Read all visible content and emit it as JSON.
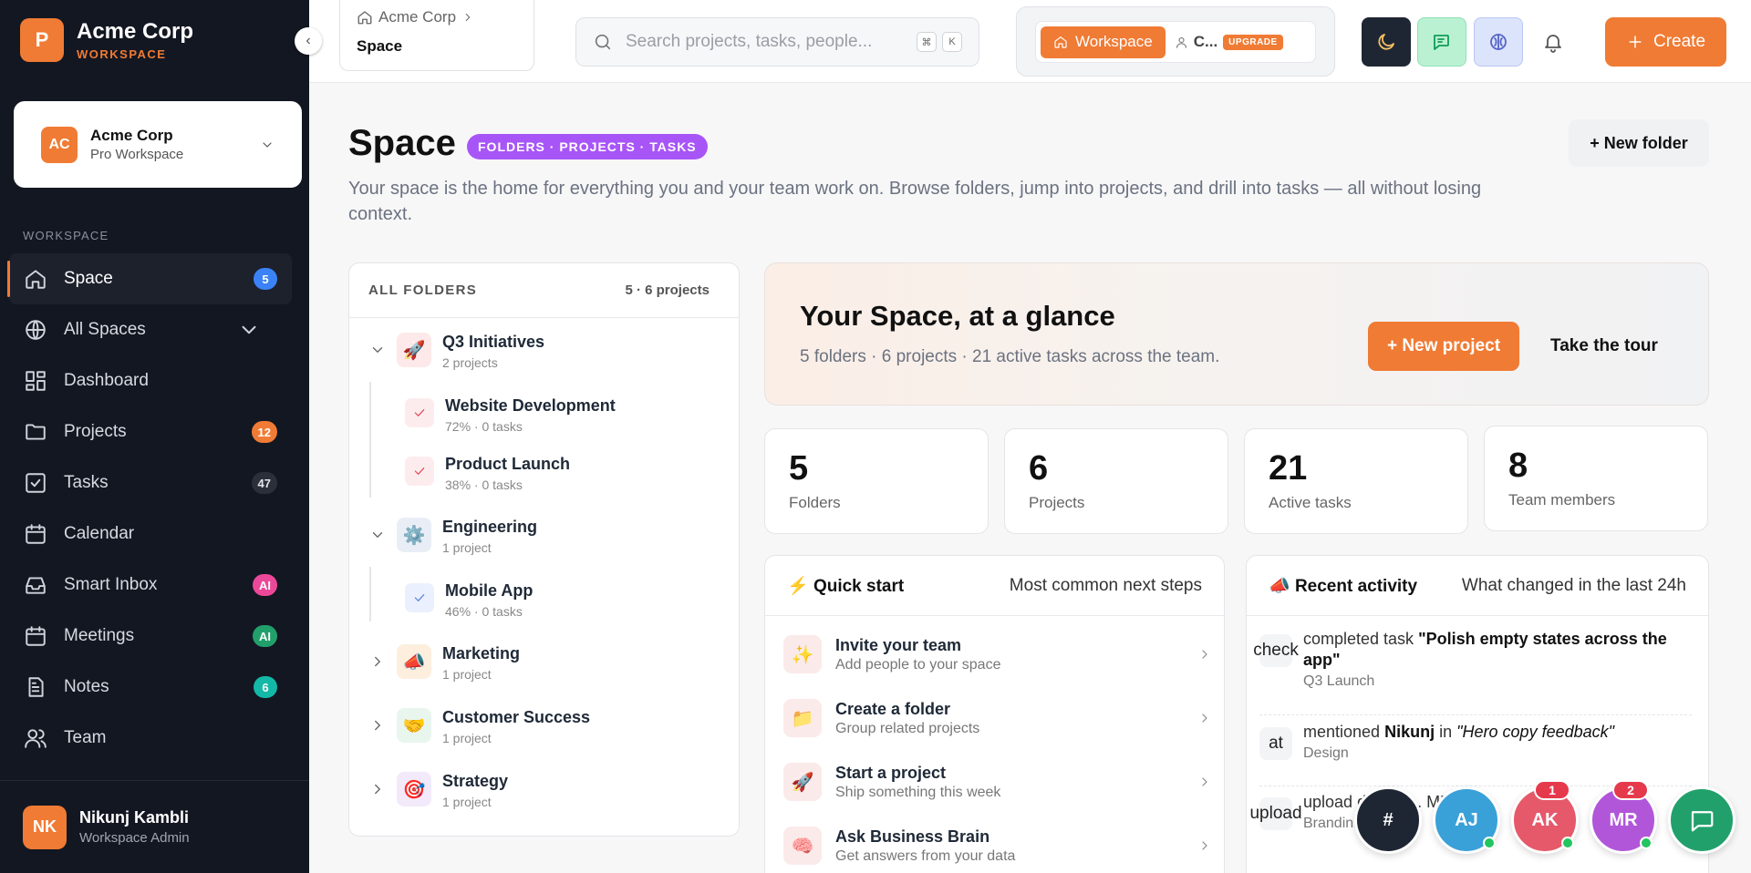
{
  "brand": {
    "logo_letter": "P",
    "name": "Acme Corp",
    "subtitle": "WORKSPACE",
    "accent": "#f07b34"
  },
  "workspace_card": {
    "initials": "AC",
    "name": "Acme Corp",
    "plan": "Pro Workspace"
  },
  "sidebar": {
    "section_label": "WORKSPACE",
    "items": [
      {
        "label": "Space",
        "icon": "home-icon",
        "badge": "5",
        "active": true
      },
      {
        "label": "All Spaces",
        "icon": "globe-icon",
        "chevron": true
      },
      {
        "label": "Dashboard",
        "icon": "dashboard-icon"
      },
      {
        "label": "Projects",
        "icon": "folder-icon",
        "badge": "12"
      },
      {
        "label": "Tasks",
        "icon": "checkbox-icon",
        "badge": "47"
      },
      {
        "label": "Calendar",
        "icon": "calendar-icon"
      },
      {
        "label": "Smart Inbox",
        "icon": "inbox-icon",
        "badge": "AI"
      },
      {
        "label": "Meetings",
        "icon": "calendar-icon",
        "badge": "AI"
      },
      {
        "label": "Notes",
        "icon": "note-icon",
        "badge": "6"
      },
      {
        "label": "Team",
        "icon": "users-icon"
      }
    ],
    "user": {
      "initials": "NK",
      "name": "Nikunj Kambli",
      "role": "Workspace Admin"
    }
  },
  "topbar": {
    "breadcrumb": {
      "parent": "Acme Corp",
      "current": "Space"
    },
    "search": {
      "placeholder": "Search projects, tasks, people...",
      "kbd1": "⌘",
      "kbd2": "K"
    },
    "mode": {
      "workspace_label": "Workspace",
      "other_label": "C...",
      "upgrade_label": "UPGRADE"
    },
    "create_label": "Create"
  },
  "page": {
    "title": "Space",
    "pill": "FOLDERS · PROJECTS · TASKS",
    "new_folder_label": "+ New folder",
    "description": "Your space is the home for everything you and your team work on. Browse folders, jump into projects, and drill into tasks — all without losing context."
  },
  "folders": {
    "header": "ALL FOLDERS",
    "count": "5 · 6 projects",
    "list": [
      {
        "name": "Q3 Initiatives",
        "sub": "2 projects",
        "emoji": "🚀",
        "expanded": true,
        "projects": [
          {
            "name": "Website Development",
            "sub": "72% · 0 tasks"
          },
          {
            "name": "Product Launch",
            "sub": "38% · 0 tasks"
          }
        ]
      },
      {
        "name": "Engineering",
        "sub": "1 project",
        "emoji": "⚙️",
        "expanded": true,
        "projects": [
          {
            "name": "Mobile App",
            "sub": "46% · 0 tasks"
          }
        ]
      },
      {
        "name": "Marketing",
        "sub": "1 project",
        "emoji": "📣",
        "expanded": false
      },
      {
        "name": "Customer Success",
        "sub": "1 project",
        "emoji": "🤝",
        "expanded": false
      },
      {
        "name": "Strategy",
        "sub": "1 project",
        "emoji": "🎯",
        "expanded": false
      }
    ]
  },
  "glance": {
    "title": "Your Space, at a glance",
    "subtitle": "5 folders · 6 projects · 21 active tasks across the team.",
    "new_project_label": "+ New project",
    "tour_label": "Take the tour"
  },
  "stats": [
    {
      "value": "5",
      "label": "Folders"
    },
    {
      "value": "6",
      "label": "Projects"
    },
    {
      "value": "21",
      "label": "Active tasks"
    },
    {
      "value": "8",
      "label": "Team members"
    }
  ],
  "quick_start": {
    "icon": "⚡",
    "title": "Quick start",
    "hint": "Most common next steps",
    "items": [
      {
        "emoji": "✨",
        "title": "Invite your team",
        "sub": "Add people to your space"
      },
      {
        "emoji": "📁",
        "title": "Create a folder",
        "sub": "Group related projects"
      },
      {
        "emoji": "🚀",
        "title": "Start a project",
        "sub": "Ship something this week"
      },
      {
        "emoji": "🧠",
        "title": "Ask Business Brain",
        "sub": "Get answers from your data"
      }
    ]
  },
  "activity": {
    "icon": "📣",
    "title": "Recent activity",
    "hint": "What changed in the last 24h",
    "items": [
      {
        "icon": "check",
        "verb": "completed task",
        "object": "\"Polish empty states across the app\"",
        "context": "Q3 Launch"
      },
      {
        "icon": "at",
        "verb": "mentioned",
        "who": "Nikunj",
        "prep": "in",
        "object": "\"Hero copy feedback\"",
        "context": "Design"
      },
      {
        "icon": "upload",
        "verb": "upload",
        "object": "d-b... p... MB",
        "context": "Brandin..."
      }
    ]
  },
  "dock": [
    {
      "label": "#",
      "kind": "channel"
    },
    {
      "label": "AJ",
      "online": true
    },
    {
      "label": "AK",
      "count": "1",
      "online": true
    },
    {
      "label": "MR",
      "count": "2",
      "online": true
    },
    {
      "label": "",
      "kind": "messages"
    }
  ]
}
